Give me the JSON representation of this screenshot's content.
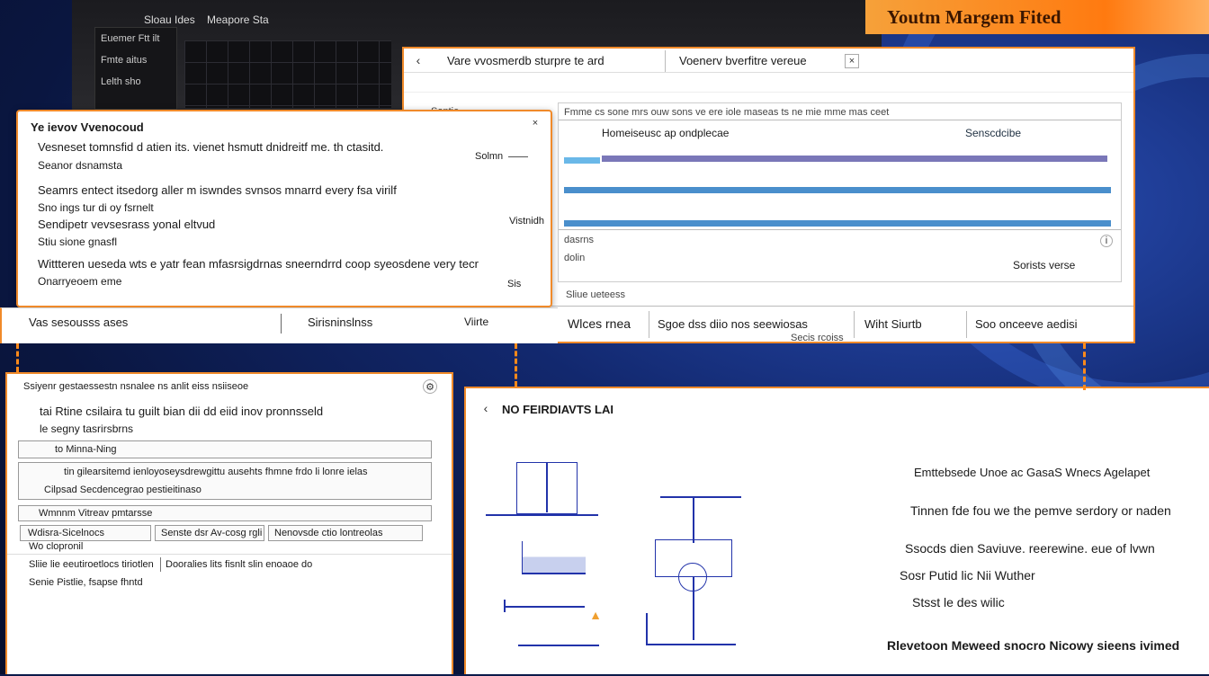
{
  "banner": {
    "title": "Youtm Margem Fited"
  },
  "top_window": {
    "menu": [
      "Sloau Ides",
      "Meapore Sta"
    ],
    "side_labels": [
      "Euemer Ftt ilt",
      "Fmte aitus",
      "Lelth sho"
    ]
  },
  "main_window": {
    "tabs": [
      "Vare vvosmerdb sturpre te ard",
      "Voenerv bverfitre vereue"
    ],
    "column_header": "Fmme cs sone mrs ouw sons ve ere iole maseas ts ne mie mme mas ceet",
    "card_title": "Homeiseusc ap ondplecae",
    "card_badge": "Senscdcibe",
    "side_labels": [
      "Sontie",
      "dasrns",
      "dolin"
    ],
    "right_text": "Sorists verse",
    "footer_note": "Sliue ueteess",
    "toolbar": [
      "Wlces rnea",
      "Sgoe dss diio nos seewiosas",
      "Wiht Siurtb",
      "Soo onceeve aedisi"
    ],
    "toolbar_sub": "Secis rcoiss"
  },
  "popup": {
    "title": "Ye ievov Vvenocoud",
    "lines": [
      "Vesneset tomnsfid d atien its. vienet hsmutt dnidreitf me. th ctasitd.",
      "Seanor dsnamsta",
      "Seamrs entect itsedorg aller m iswndes svnsos mnarrd every fsa virilf",
      "Sno ings tur di oy fsrnelt",
      "Sendipetr vevsesrass yonal eltvud",
      "Stiu sione gnasfl",
      "Wittteren ueseda wts e yatr fean mfasrsigdrnas sneerndrrd coop syeosdene very tecr",
      "Onarryeoem eme"
    ],
    "side_labels": [
      "Solmn",
      "Vistnidh",
      "Sis"
    ],
    "footer": [
      "Vas sesousss ases",
      "Sirisninslnss",
      "Viirte"
    ]
  },
  "left_window": {
    "title": "Ssiyenr gestaessestn nsnalee ns anlit eiss nsiiseoe",
    "rows": [
      "tai Rtine csilaira tu guilt bian dii dd eiid inov pronnsseld",
      "le segny tasrirsbrns",
      "to Minna-Ning",
      "tin gilearsitemd ienloyoseysdrewgittu ausehts fhmne frdo li lonre ielas",
      "Cilpsad Secdencegrao pestieitinaso",
      "Wmnnm Vitreav pmtarsse",
      "Wdisra-Sicelnocs",
      "Senste dsr Av-cosg rgli",
      "Nenovsde ctio lontreolas",
      "Wo clopronil",
      "Sliie lie eeutiroetlocs tiriotlen",
      "Dooralies lits fisnlt slin enoaoe do",
      "Senie Pistlie, fsapse fhntd"
    ]
  },
  "right_window": {
    "heading": "NO FEIRDIAVTS LAI",
    "notes": [
      "Emttebsede Unoe ac GasaS Wnecs Agelapet",
      "Tinnen fde fou we the pemve serdory or naden",
      "Ssocds dien Saviuve. reerewine. eue of lvwn",
      "Sosr Putid lic Nii Wuther",
      "Stsst le des wilic",
      "Rlevetoon Meweed snocro Nicowy sieens ivimed"
    ]
  }
}
